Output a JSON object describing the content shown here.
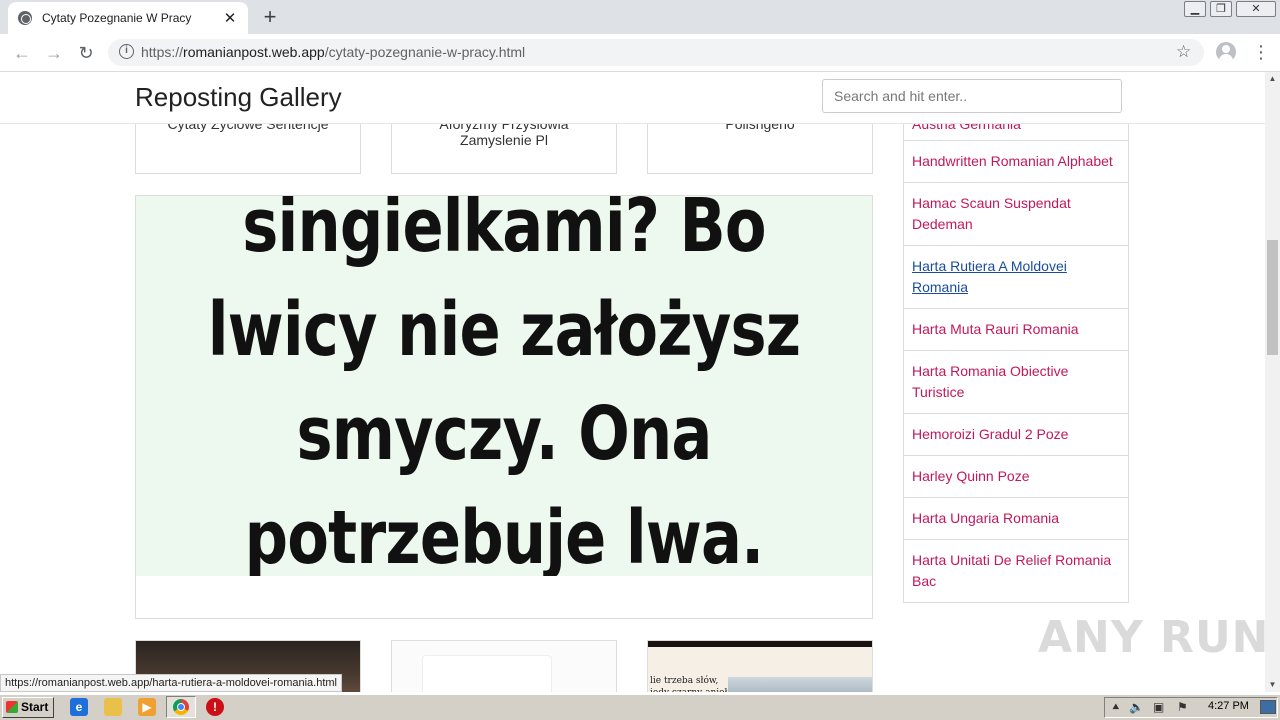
{
  "browser": {
    "tab_title": "Cytaty Pozegnanie W Pracy",
    "tab_close": "✕",
    "new_tab": "+",
    "url_scheme": "https://",
    "url_host": "romanianpost.web.app",
    "url_path": "/cytaty-pozegnanie-w-pracy.html",
    "status_url": "https://romanianpost.web.app/harta-rutiera-a-moldovei-romania.html"
  },
  "header": {
    "brand": "Reposting Gallery",
    "search_placeholder": "Search and hit enter.."
  },
  "top_cards": [
    {
      "label": "Cytaty Zyciowe Sentencje"
    },
    {
      "label": "Aforyzmy Przyslowia Zamyslenie Pl"
    },
    {
      "label": "Polishgeno"
    }
  ],
  "main_image": {
    "text_lines": [
      "singielkami? Bo",
      "lwicy nie założysz",
      "smyczy. Ona",
      "potrzebuje lwa."
    ]
  },
  "sidebar": {
    "items": [
      {
        "label": "Austria Germania"
      },
      {
        "label": "Handwritten Romanian Alphabet"
      },
      {
        "label": "Hamac Scaun Suspendat Dedeman"
      },
      {
        "label": "Harta Rutiera A Moldovei Romania"
      },
      {
        "label": "Harta Muta Rauri Romania"
      },
      {
        "label": "Harta Romania Obiective Turistice"
      },
      {
        "label": "Hemoroizi Gradul 2 Poze"
      },
      {
        "label": "Harley Quinn Poze"
      },
      {
        "label": "Harta Ungaria Romania"
      },
      {
        "label": "Harta Unitati De Relief Romania Bac"
      }
    ]
  },
  "thumbs": [
    {
      "text": ""
    },
    {
      "text": ""
    },
    {
      "text": "lie trzeba słów, iedy czarny anioł"
    }
  ],
  "watermark": "ANY RUN",
  "taskbar": {
    "start_label": "Start",
    "clock": "4:27 PM"
  },
  "colors": {
    "link": "#c2185b",
    "link_hover": "#1a4c9b",
    "image_bg": "#edf8ef"
  }
}
